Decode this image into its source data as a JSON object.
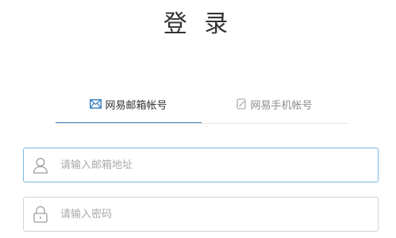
{
  "page": {
    "title": "登 录"
  },
  "tabs": [
    {
      "label": "网易邮箱帐号",
      "icon": "mail-icon",
      "active": true
    },
    {
      "label": "网易手机帐号",
      "icon": "phone-icon",
      "active": false
    }
  ],
  "form": {
    "email": {
      "value": "",
      "placeholder": "请输入邮箱地址",
      "icon": "user-icon"
    },
    "password": {
      "value": "",
      "placeholder": "请输入密码",
      "icon": "lock-icon"
    }
  },
  "colors": {
    "accent": "#3e86c4",
    "focus_border": "#7fb8e0",
    "border": "#d4d4d4"
  }
}
